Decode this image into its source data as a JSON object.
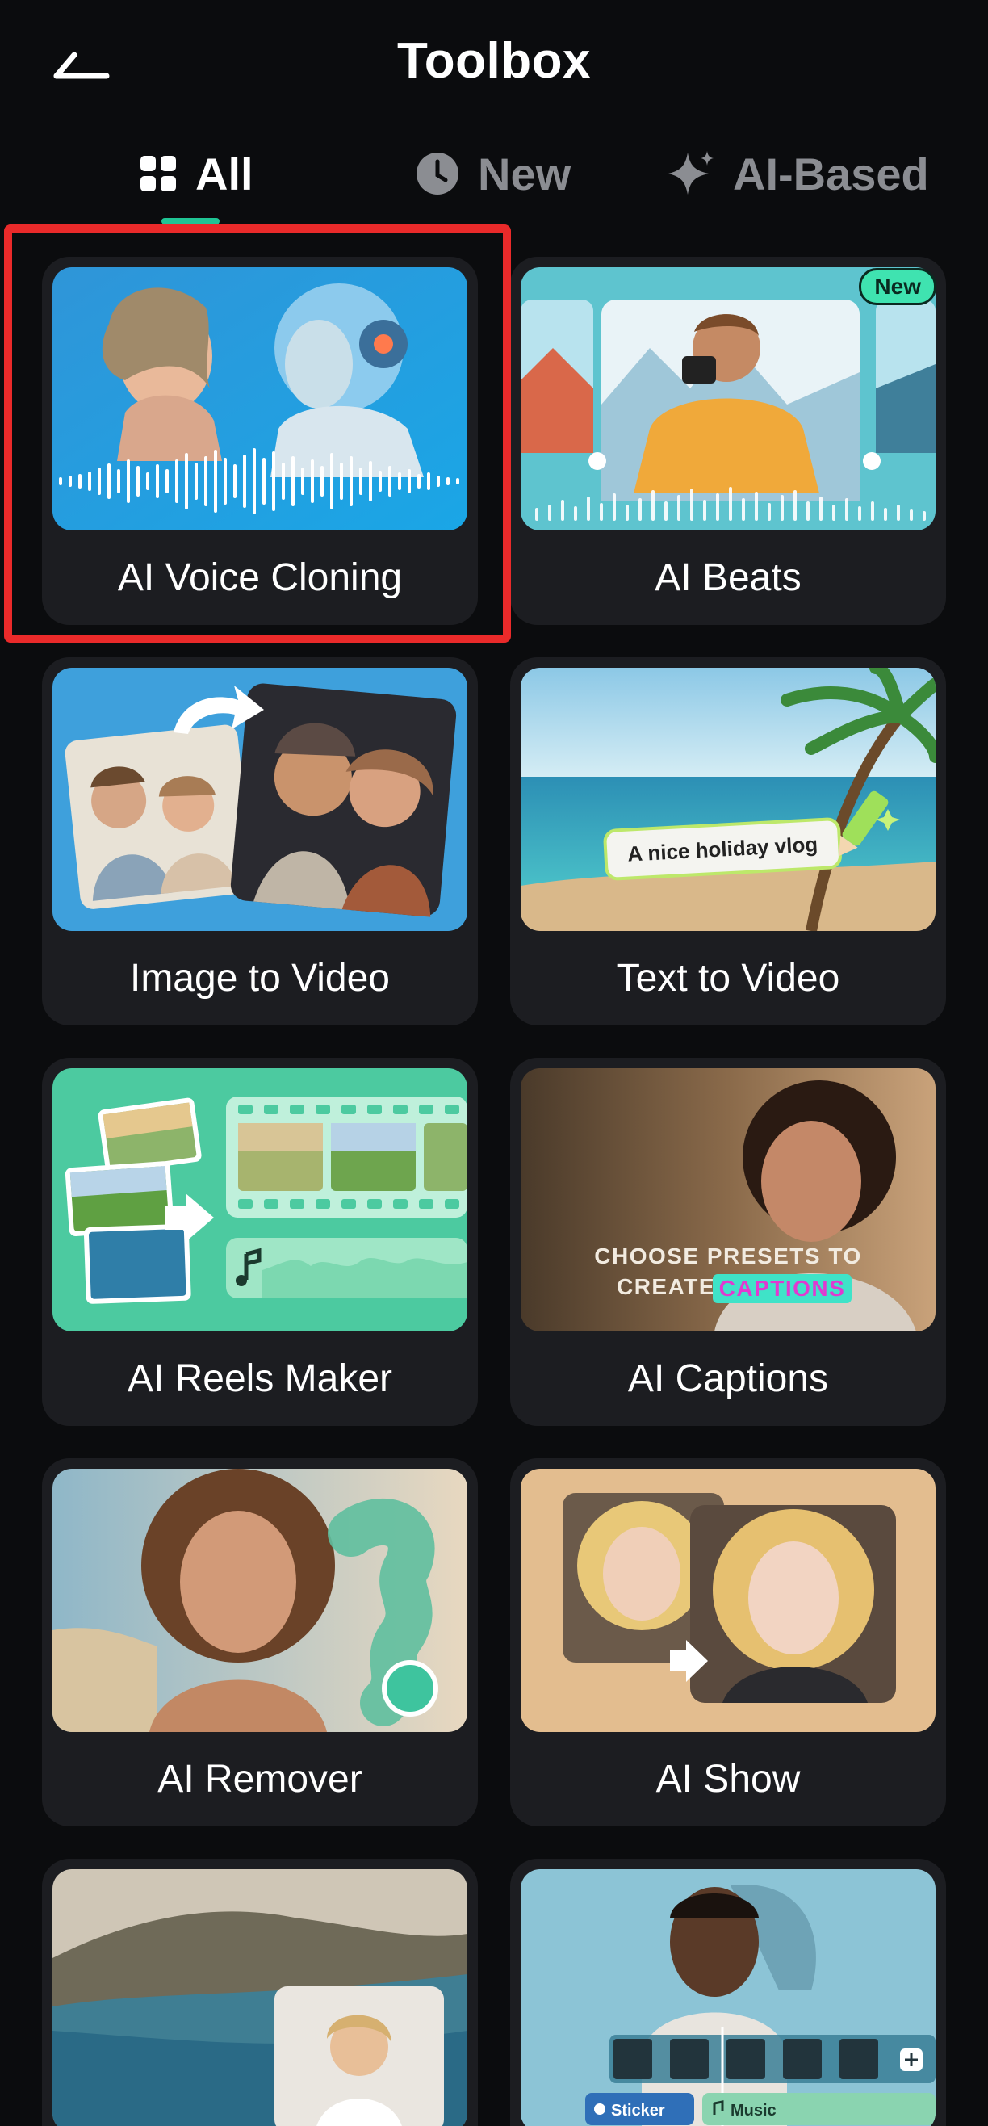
{
  "header": {
    "title": "Toolbox"
  },
  "tabs": [
    {
      "label": "All"
    },
    {
      "label": "New"
    },
    {
      "label": "AI-Based"
    }
  ],
  "cards": [
    {
      "label": "AI Voice Cloning"
    },
    {
      "label": "AI Beats",
      "badge": "New"
    },
    {
      "label": "Image to Video"
    },
    {
      "label": "Text to Video",
      "overlay": "A nice holiday vlog"
    },
    {
      "label": "AI Reels Maker"
    },
    {
      "label": "AI Captions",
      "overlay_line1": "CHOOSE PRESETS TO",
      "overlay_line2a": "CREATE",
      "overlay_line2b": "CAPTIONS"
    },
    {
      "label": "AI Remover"
    },
    {
      "label": "AI Show"
    },
    {
      "label": ""
    },
    {
      "label": "",
      "chip1": "Sticker",
      "chip2": "Music"
    }
  ],
  "colors": {
    "accent": "#1fc594",
    "highlight": "#ea2a2a",
    "card_bg": "#1c1d21",
    "bg": "#0b0c0e"
  }
}
